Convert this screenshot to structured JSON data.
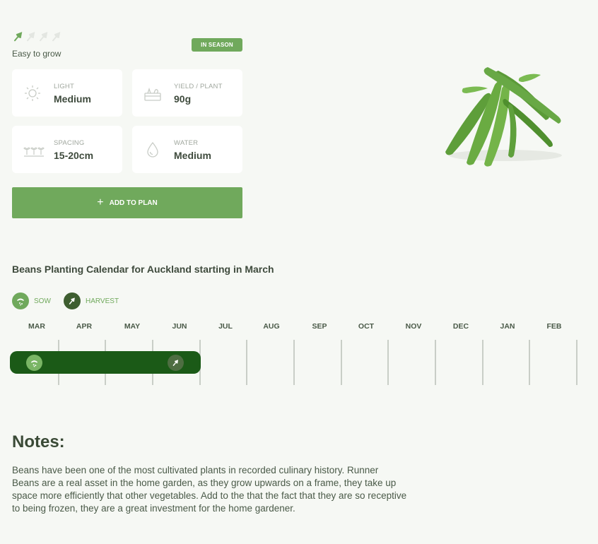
{
  "difficulty": {
    "label": "Easy to grow",
    "level": 1,
    "max": 4,
    "icon": "trowel-icon",
    "active_color": "#70a95c",
    "inactive_color": "#e3e6e1"
  },
  "season_badge": "IN SEASON",
  "stats": [
    {
      "label": "LIGHT",
      "value": "Medium",
      "icon": "sun-icon"
    },
    {
      "label": "YIELD / PLANT",
      "value": "90g",
      "icon": "basket-icon"
    },
    {
      "label": "SPACING",
      "value": "15-20cm",
      "icon": "seedlings-icon"
    },
    {
      "label": "WATER",
      "value": "Medium",
      "icon": "water-drop-icon"
    }
  ],
  "add_button": {
    "label": "ADD TO PLAN",
    "icon": "plus-icon"
  },
  "calendar": {
    "title": "Beans Planting Calendar for Auckland starting in March",
    "legend": [
      {
        "label": "SOW",
        "icon": "sow-icon",
        "color": "#70a95c"
      },
      {
        "label": "HARVEST",
        "icon": "harvest-trowel-icon",
        "color": "#3e5e30"
      }
    ],
    "months": [
      "MAR",
      "APR",
      "MAY",
      "JUN",
      "JUL",
      "AUG",
      "SEP",
      "OCT",
      "NOV",
      "DEC",
      "JAN",
      "FEB"
    ],
    "period": {
      "start_month": "MAR",
      "end_month": "JUN",
      "color": "#1b5a17"
    }
  },
  "notes": {
    "title": "Notes:",
    "body": "Beans have been one of the most cultivated plants in recorded culinary history. Runner Beans are a real asset in the home garden, as they grow upwards on a frame, they take up space more efficiently that other vegetables. Add to the that the fact that they are so receptive to being frozen, they are a great investment for the home gardener."
  },
  "colors": {
    "accent": "#70a95c",
    "dark_green": "#1b5a17",
    "background": "#f6f8f4"
  }
}
